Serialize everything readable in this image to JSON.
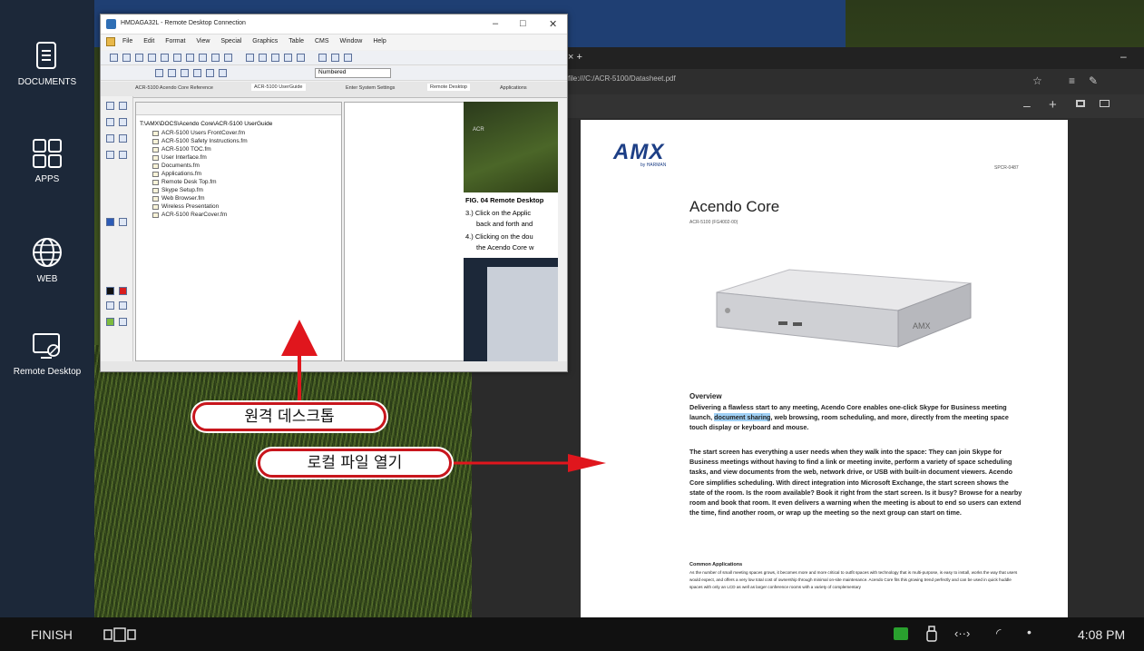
{
  "sidebar": {
    "items": [
      {
        "label": "DOCUMENTS",
        "icon": "document-icon"
      },
      {
        "label": "APPS",
        "icon": "apps-grid-icon"
      },
      {
        "label": "WEB",
        "icon": "globe-icon"
      },
      {
        "label": "Remote Desktop",
        "icon": "remote-desktop-icon"
      }
    ]
  },
  "taskbar": {
    "finish_label": "FINISH",
    "clock": "4:08 PM"
  },
  "remote_window": {
    "title": "HMDAGA32L - Remote Desktop Connection",
    "menu": [
      "File",
      "Edit",
      "Format",
      "View",
      "Special",
      "Graphics",
      "Table",
      "CMS",
      "Window",
      "Help"
    ],
    "font_select": "Numbered",
    "tabs": [
      "ACR-5100 Acendo Core Reference",
      "ACR-5100 UserGuide",
      "Enter System Settings",
      "Remote Desktop",
      "Applications"
    ],
    "tree_root": "T:\\AMX\\DOCS\\Acendo Core\\ACR-5100 UserGuide",
    "tree_items": [
      "ACR-5100 Users FrontCover.fm",
      "ACR-5100 Safety Instructions.fm",
      "ACR-5100 TOC.fm",
      "User Interface.fm",
      "Documents.fm",
      "Applications.fm",
      "Remote Desk Top.fm",
      "Skype Setup.fm",
      "Web Browser.fm",
      "Wireless Presentation",
      "ACR-5100 RearCover.fm"
    ],
    "doc_lines": [
      "FIG. 04 Remote Desktop",
      "3.)  Click on the Applic",
      "back and forth and",
      "4.)  Clicking on the dou",
      "the Acendo Core w"
    ],
    "doc_image_label": "ACR"
  },
  "browser": {
    "url": "file:///C:/ACR-5100/Datasheet.pdf",
    "pdf": {
      "logo": "AMX",
      "logo_sub": "by HARMAN",
      "top_right_code": "SPCR-0487",
      "title": "Acendo Core",
      "subtitle": "ACR-5100 (FG4002-00)",
      "overview_heading": "Overview",
      "para1_before": "Delivering a flawless start to any meeting, Acendo Core enables one-click Skype for Business meeting launch, ",
      "para1_highlight": "document sharing",
      "para1_after": ", web browsing, room scheduling, and more, directly from the meeting space touch display or keyboard and mouse.",
      "para2": "The start screen has everything a user needs when they walk into the space: They can join Skype for Business meetings without having to find a link or meeting invite, perform a variety of space scheduling tasks, and view documents from the web, network drive, or USB with built-in document viewers. Acendo Core simplifies scheduling. With direct integration into Microsoft Exchange, the start screen shows the state of the room. Is the room available? Book it right from the start screen. Is it busy? Browse for a nearby room and book that room. It even delivers a warning when the meeting is about to end so users can extend the time, find another room, or wrap up the meeting so the next group can start on time.",
      "apps_heading": "Common Applications",
      "apps_text": "As the number of small meeting spaces grows, it becomes more and more critical to outfit spaces with technology that is multi-purpose, is easy to install, works the way that users would expect, and offers a very low total cost of ownership through minimal on-site maintenance. Acendo Core fits this growing trend perfectly and can be used in quick huddle spaces with only an LCD as well as larger conference rooms with a variety of complementary",
      "product_label": "AMX"
    }
  },
  "callouts": {
    "remote_desktop": "원격 데스크톱",
    "open_local_file": "로컬 파일 열기"
  },
  "colors": {
    "sidebar_bg": "#1c2839",
    "callout_border": "#c8161d",
    "highlight": "#9fd0f5",
    "taskbar_bg": "#111111"
  }
}
